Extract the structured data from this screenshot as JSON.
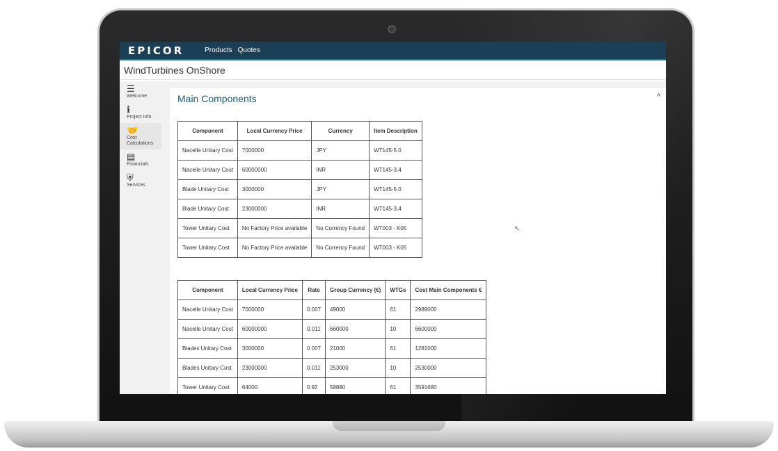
{
  "nav": {
    "logo": "EPICOR",
    "links": [
      "Products",
      "Quotes"
    ]
  },
  "app": {
    "title": "WindTurbines OnShore"
  },
  "sidebar": {
    "items": [
      {
        "label": "Welcome",
        "icon": "menu-icon",
        "glyph": "☰"
      },
      {
        "label": "Project Info",
        "icon": "info-icon",
        "glyph": "ℹ"
      },
      {
        "label": "Cost Calculations",
        "icon": "handshake-icon",
        "glyph": "🤝"
      },
      {
        "label": "Financials",
        "icon": "document-icon",
        "glyph": "▤"
      },
      {
        "label": "Services",
        "icon": "shield-icon",
        "glyph": "⛨"
      }
    ]
  },
  "section": {
    "title": "Main Components",
    "collapse_glyph": "^"
  },
  "table1": {
    "headers": [
      "Component",
      "Local Currency Price",
      "Currency",
      "Item Description"
    ],
    "rows": [
      [
        "Nacelle Unitary Cost",
        "7000000",
        "JPY",
        "WT145-5.0"
      ],
      [
        "Nacelle Unitary Cost",
        "60000000",
        "INR",
        "WT145-3.4"
      ],
      [
        "Blade Unitary Cost",
        "3000000",
        "JPY",
        "WT145-5.0"
      ],
      [
        "Blade Unitary Cost",
        "23000000",
        "INR",
        "WT145-3.4"
      ],
      [
        "Tower Unitary Cost",
        "No Factory Price available",
        "No Currency Found",
        "WT003 - K05"
      ],
      [
        "Tower Unitary Cost",
        "No Factory Price available",
        "No Currency Found",
        "WT003 - K05"
      ]
    ]
  },
  "table2": {
    "headers": [
      "Component",
      "Local Currency Price",
      "Rate",
      "Group Currency (€)",
      "WTGs",
      "Cost Main Components €"
    ],
    "rows": [
      [
        "Nacelle Unitary Cost",
        "7000000",
        "0.007",
        "49000",
        "61",
        "2989000"
      ],
      [
        "Nacelle Unitary Cost",
        "60000000",
        "0.011",
        "660000",
        "10",
        "6600000"
      ],
      [
        "Blades Unitary Cost",
        "3000000",
        "0.007",
        "21000",
        "61",
        "1281000"
      ],
      [
        "Blades Unitary Cost",
        "23000000",
        "0.011",
        "253000",
        "10",
        "2530000"
      ],
      [
        "Tower Unitary Cost",
        "64000",
        "0.92",
        "58880",
        "61",
        "3591680"
      ]
    ]
  }
}
